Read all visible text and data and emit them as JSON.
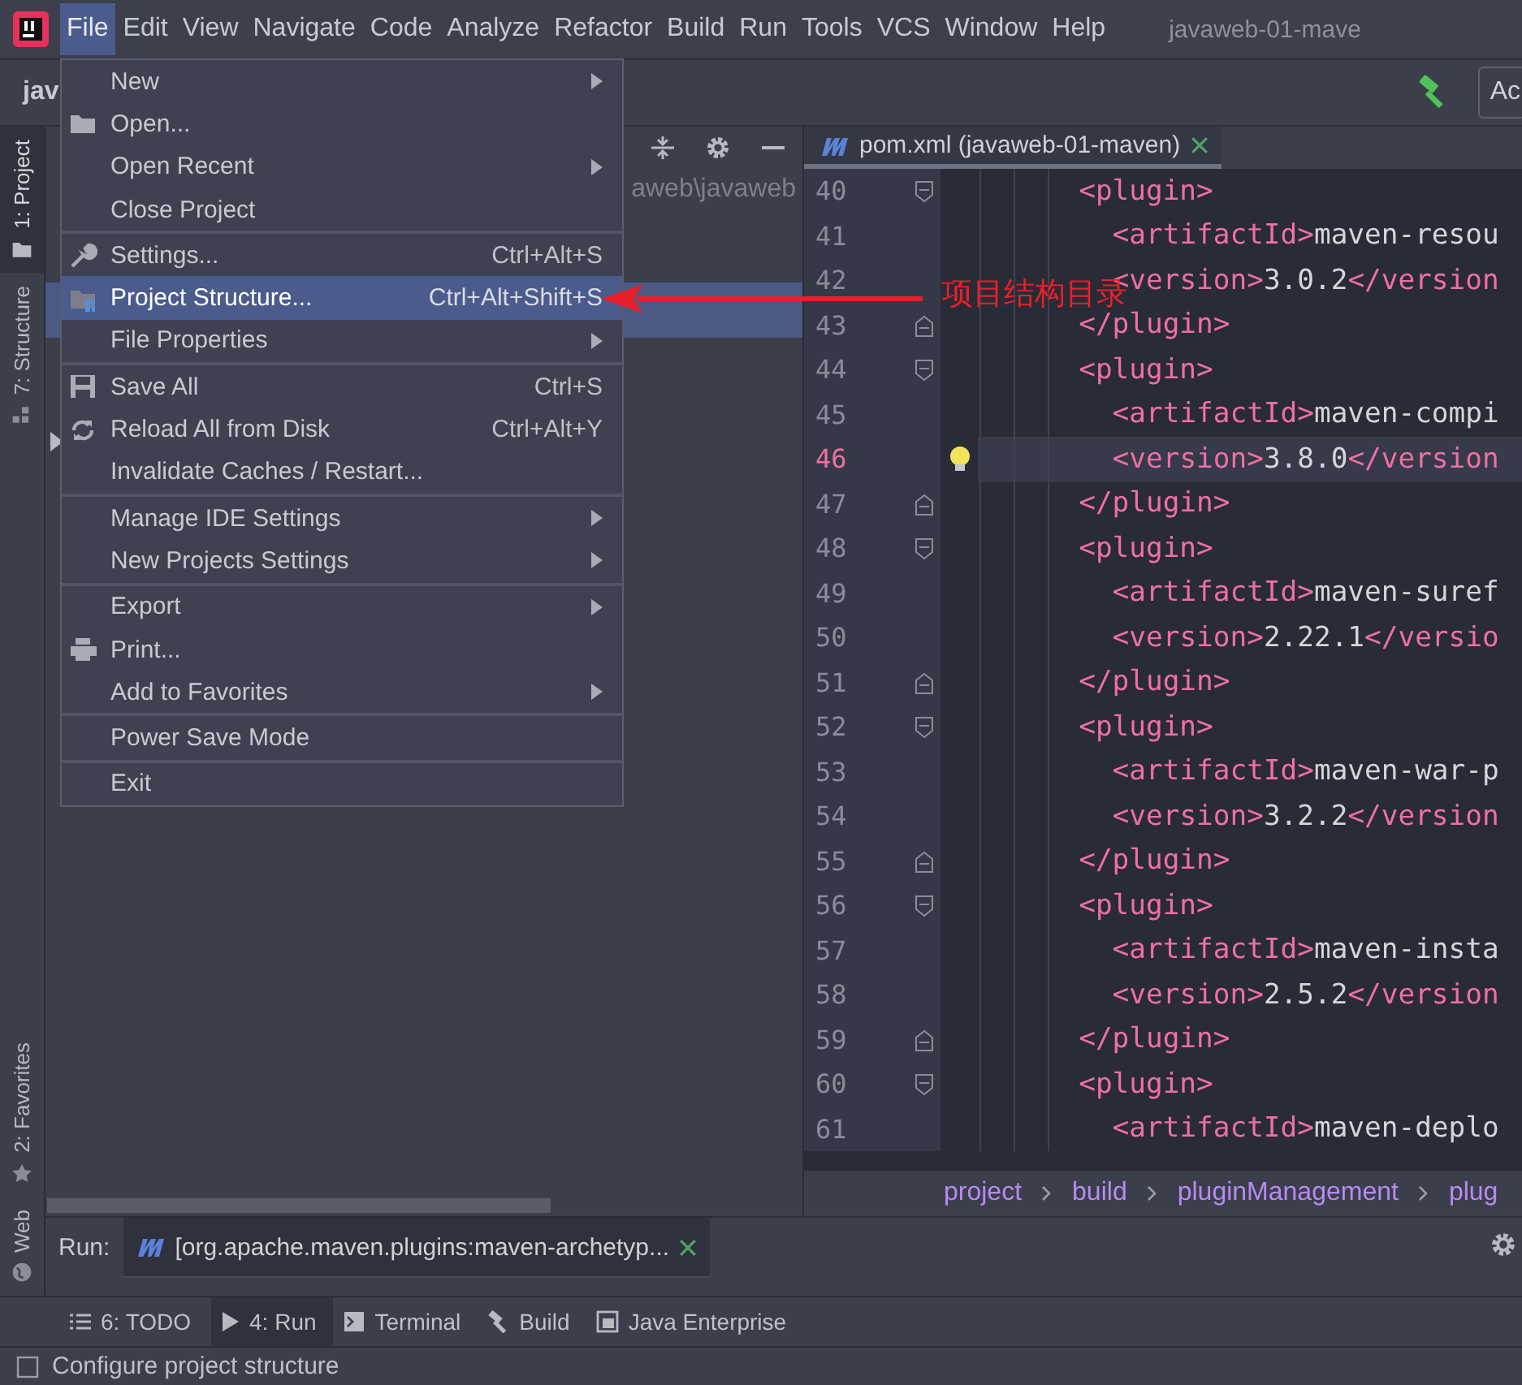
{
  "menu_bar": {
    "items": [
      {
        "label": "File",
        "selected": true
      },
      {
        "label": "Edit",
        "selected": false
      },
      {
        "label": "View",
        "selected": false
      },
      {
        "label": "Navigate",
        "selected": false
      },
      {
        "label": "Code",
        "selected": false
      },
      {
        "label": "Analyze",
        "selected": false
      },
      {
        "label": "Refactor",
        "selected": false
      },
      {
        "label": "Build",
        "selected": false
      },
      {
        "label": "Run",
        "selected": false
      },
      {
        "label": "Tools",
        "selected": false
      },
      {
        "label": "VCS",
        "selected": false
      },
      {
        "label": "Window",
        "selected": false
      },
      {
        "label": "Help",
        "selected": false
      }
    ],
    "title": "javaweb-01-mave"
  },
  "toolbar": {
    "project_label": "jav",
    "run_config": "Ac"
  },
  "side_tabs": [
    {
      "label": "1: Project",
      "selected": true
    },
    {
      "label": "7: Structure",
      "selected": false
    },
    {
      "label": "2: Favorites",
      "selected": false
    },
    {
      "label": "Web",
      "selected": false
    }
  ],
  "project_panel": {
    "path": "aweb\\javaweb"
  },
  "file_menu": {
    "groups": [
      [
        {
          "label": "New",
          "submenu": true,
          "selected": false
        },
        {
          "label": "Open...",
          "submenu": false,
          "selected": false
        },
        {
          "label": "Open Recent",
          "submenu": true,
          "selected": false
        },
        {
          "label": "Close Project",
          "submenu": false,
          "selected": false
        }
      ],
      [
        {
          "label": "Settings...",
          "shortcut": "Ctrl+Alt+S",
          "submenu": false,
          "selected": false
        },
        {
          "label": "Project Structure...",
          "shortcut": "Ctrl+Alt+Shift+S",
          "submenu": false,
          "selected": true
        },
        {
          "label": "File Properties",
          "submenu": true,
          "selected": false
        }
      ],
      [
        {
          "label": "Save All",
          "shortcut": "Ctrl+S",
          "submenu": false,
          "selected": false
        },
        {
          "label": "Reload All from Disk",
          "shortcut": "Ctrl+Alt+Y",
          "submenu": false,
          "selected": false
        },
        {
          "label": "Invalidate Caches / Restart...",
          "submenu": false,
          "selected": false
        }
      ],
      [
        {
          "label": "Manage IDE Settings",
          "submenu": true,
          "selected": false
        },
        {
          "label": "New Projects Settings",
          "submenu": true,
          "selected": false
        }
      ],
      [
        {
          "label": "Export",
          "submenu": true,
          "selected": false
        },
        {
          "label": "Print...",
          "submenu": false,
          "selected": false
        },
        {
          "label": "Add to Favorites",
          "submenu": true,
          "selected": false
        }
      ],
      [
        {
          "label": "Power Save Mode",
          "submenu": false,
          "selected": false
        }
      ],
      [
        {
          "label": "Exit",
          "submenu": false,
          "selected": false
        }
      ]
    ]
  },
  "editor": {
    "tab": {
      "label": "pom.xml (javaweb-01-maven)",
      "selected": true
    },
    "lines": [
      {
        "number": "40",
        "text": "      <plugin>",
        "fold_start": true
      },
      {
        "number": "41",
        "text": "        <artifactId>maven-resou"
      },
      {
        "number": "42",
        "text": "        <version>3.0.2</version"
      },
      {
        "number": "43",
        "text": "      </plugin>",
        "fold_end": true
      },
      {
        "number": "44",
        "text": "      <plugin>",
        "fold_start": true
      },
      {
        "number": "45",
        "text": "        <artifactId>maven-compi"
      },
      {
        "number": "46",
        "text": "        <version>3.8.0</version",
        "current": true,
        "intention": true
      },
      {
        "number": "47",
        "text": "      </plugin>",
        "fold_end": true
      },
      {
        "number": "48",
        "text": "      <plugin>",
        "fold_start": true
      },
      {
        "number": "49",
        "text": "        <artifactId>maven-suref"
      },
      {
        "number": "50",
        "text": "        <version>2.22.1</versio"
      },
      {
        "number": "51",
        "text": "      </plugin>",
        "fold_end": true
      },
      {
        "number": "52",
        "text": "      <plugin>",
        "fold_start": true
      },
      {
        "number": "53",
        "text": "        <artifactId>maven-war-p"
      },
      {
        "number": "54",
        "text": "        <version>3.2.2</version"
      },
      {
        "number": "55",
        "text": "      </plugin>",
        "fold_end": true
      },
      {
        "number": "56",
        "text": "      <plugin>",
        "fold_start": true
      },
      {
        "number": "57",
        "text": "        <artifactId>maven-insta"
      },
      {
        "number": "58",
        "text": "        <version>2.5.2</version"
      },
      {
        "number": "59",
        "text": "      </plugin>",
        "fold_end": true
      },
      {
        "number": "60",
        "text": "      <plugin>",
        "fold_start": true
      },
      {
        "number": "61",
        "text": "        <artifactId>maven-deplo"
      }
    ],
    "breadcrumbs": [
      "project",
      "build",
      "pluginManagement",
      "plug"
    ]
  },
  "run_panel": {
    "label": "Run:",
    "tab": "[org.apache.maven.plugins:maven-archetyp..."
  },
  "tool_tabs": [
    {
      "label": "6: TODO",
      "selected": false
    },
    {
      "label": "4: Run",
      "selected": true
    },
    {
      "label": "Terminal",
      "selected": false
    },
    {
      "label": "Build",
      "selected": false
    },
    {
      "label": "Java Enterprise",
      "selected": false
    }
  ],
  "status_bar": {
    "message": "Configure project structure"
  },
  "annotation": {
    "text": "项目结构目录"
  }
}
